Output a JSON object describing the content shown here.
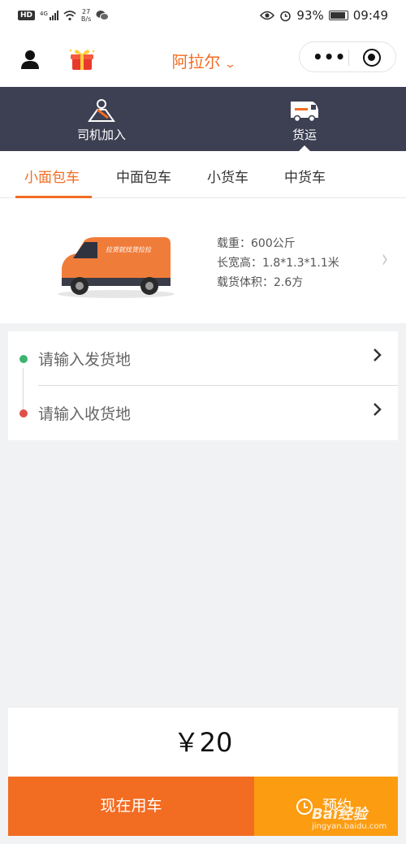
{
  "status_bar": {
    "hd": "HD",
    "network": "4G",
    "speed": "27",
    "speed_unit": "B/s",
    "battery": "93%",
    "time": "09:49"
  },
  "header": {
    "city": "阿拉尔",
    "dropdown_icon": "chevron-down-icon",
    "accent_color": "#f26c22"
  },
  "modes": [
    {
      "label": "司机加入",
      "icon": "driver-icon"
    },
    {
      "label": "货运",
      "icon": "van-icon",
      "selected": true
    }
  ],
  "tabs": [
    {
      "label": "小面包车",
      "active": true
    },
    {
      "label": "中面包车"
    },
    {
      "label": "小货车"
    },
    {
      "label": "中货车"
    }
  ],
  "vehicle": {
    "brand_text": "拉货就找货拉拉",
    "specs": [
      "载重：600公斤",
      "长宽高：1.8*1.3*1.1米",
      "载货体积：2.6方"
    ]
  },
  "address": {
    "from_placeholder": "请输入发货地",
    "to_placeholder": "请输入收货地",
    "from_dot_color": "#3cb371",
    "to_dot_color": "#e0504a"
  },
  "price": {
    "text": "￥20"
  },
  "actions": {
    "now_label": "现在用车",
    "book_label": "预约",
    "now_color": "#f26c22",
    "book_color": "#fc9c11"
  },
  "watermark": {
    "brand": "Bai经验",
    "url": "jingyan.baidu.com"
  }
}
